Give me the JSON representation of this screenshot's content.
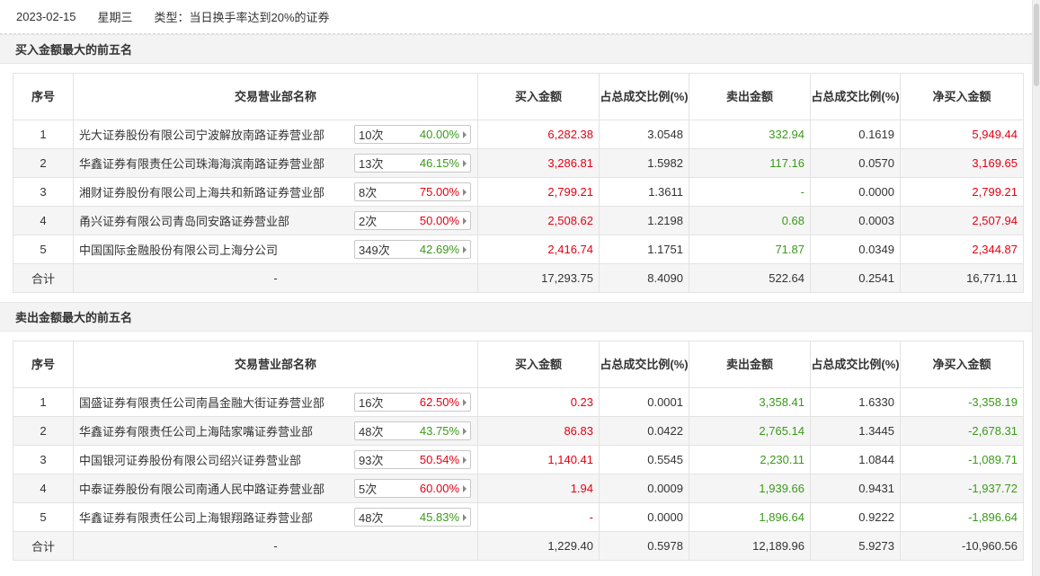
{
  "header": {
    "date": "2023-02-15",
    "weekday": "星期三",
    "type_text": "类型：当日换手率达到20%的证券"
  },
  "columns": {
    "seq": "序号",
    "dept": "交易营业部名称",
    "buy": "买入金额",
    "buy_pct": "占总成交比例(%)",
    "sell": "卖出金额",
    "sell_pct": "占总成交比例(%)",
    "net": "净买入金额"
  },
  "colors": {
    "up": "#e60012",
    "down": "#3a9a1a"
  },
  "buy_section": {
    "title": "买入金额最大的前五名",
    "rows": [
      {
        "seq": "1",
        "name": "光大证券股份有限公司宁波解放南路证券营业部",
        "count": "10次",
        "rate": "40.00%",
        "buy": "6,282.38",
        "buy_pct": "3.0548",
        "sell": "332.94",
        "sell_pct": "0.1619",
        "net": "5,949.44"
      },
      {
        "seq": "2",
        "name": "华鑫证券有限责任公司珠海海滨南路证券营业部",
        "count": "13次",
        "rate": "46.15%",
        "buy": "3,286.81",
        "buy_pct": "1.5982",
        "sell": "117.16",
        "sell_pct": "0.0570",
        "net": "3,169.65"
      },
      {
        "seq": "3",
        "name": "湘财证券股份有限公司上海共和新路证券营业部",
        "count": "8次",
        "rate": "75.00%",
        "buy": "2,799.21",
        "buy_pct": "1.3611",
        "sell": "-",
        "sell_pct": "0.0000",
        "net": "2,799.21"
      },
      {
        "seq": "4",
        "name": "甬兴证券有限公司青岛同安路证券营业部",
        "count": "2次",
        "rate": "50.00%",
        "buy": "2,508.62",
        "buy_pct": "1.2198",
        "sell": "0.68",
        "sell_pct": "0.0003",
        "net": "2,507.94"
      },
      {
        "seq": "5",
        "name": "中国国际金融股份有限公司上海分公司",
        "count": "349次",
        "rate": "42.69%",
        "buy": "2,416.74",
        "buy_pct": "1.1751",
        "sell": "71.87",
        "sell_pct": "0.0349",
        "net": "2,344.87"
      }
    ],
    "total": {
      "label": "合计",
      "dept": "-",
      "buy": "17,293.75",
      "buy_pct": "8.4090",
      "sell": "522.64",
      "sell_pct": "0.2541",
      "net": "16,771.11"
    }
  },
  "sell_section": {
    "title": "卖出金额最大的前五名",
    "rows": [
      {
        "seq": "1",
        "name": "国盛证券有限责任公司南昌金融大街证券营业部",
        "count": "16次",
        "rate": "62.50%",
        "buy": "0.23",
        "buy_pct": "0.0001",
        "sell": "3,358.41",
        "sell_pct": "1.6330",
        "net": "-3,358.19"
      },
      {
        "seq": "2",
        "name": "华鑫证券有限责任公司上海陆家嘴证券营业部",
        "count": "48次",
        "rate": "43.75%",
        "buy": "86.83",
        "buy_pct": "0.0422",
        "sell": "2,765.14",
        "sell_pct": "1.3445",
        "net": "-2,678.31"
      },
      {
        "seq": "3",
        "name": "中国银河证券股份有限公司绍兴证券营业部",
        "count": "93次",
        "rate": "50.54%",
        "buy": "1,140.41",
        "buy_pct": "0.5545",
        "sell": "2,230.11",
        "sell_pct": "1.0844",
        "net": "-1,089.71"
      },
      {
        "seq": "4",
        "name": "中泰证券股份有限公司南通人民中路证券营业部",
        "count": "5次",
        "rate": "60.00%",
        "buy": "1.94",
        "buy_pct": "0.0009",
        "sell": "1,939.66",
        "sell_pct": "0.9431",
        "net": "-1,937.72"
      },
      {
        "seq": "5",
        "name": "华鑫证券有限责任公司上海银翔路证券营业部",
        "count": "48次",
        "rate": "45.83%",
        "buy": "-",
        "buy_pct": "0.0000",
        "sell": "1,896.64",
        "sell_pct": "0.9222",
        "net": "-1,896.64"
      }
    ],
    "total": {
      "label": "合计",
      "dept": "-",
      "buy": "1,229.40",
      "buy_pct": "0.5978",
      "sell": "12,189.96",
      "sell_pct": "5.9273",
      "net": "-10,960.56"
    }
  }
}
